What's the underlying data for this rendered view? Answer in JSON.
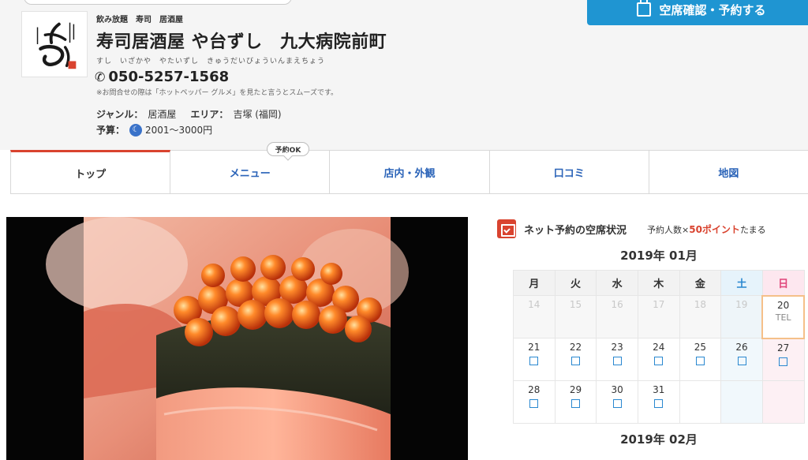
{
  "header": {
    "tags": [
      "飲み放題",
      "寿司",
      "居酒屋"
    ],
    "shop_name": "寿司居酒屋 や台ずし　九大病院前町",
    "shop_kana": "すし　いざかや　やたいずし　きゅうだいびょういんまえちょう",
    "phone": "050-5257-1568",
    "phone_note": "※お問合せの際は「ホットペッパー グルメ」を見たと言うとスムーズです。",
    "genre_label": "ジャンル：",
    "genre_value": "居酒屋",
    "area_label": "エリア：",
    "area_value": "吉塚 (福岡)",
    "budget_label": "予算：",
    "budget_value": "2001～3000円",
    "reserve_button": "空席確認・予約する"
  },
  "tabs": {
    "badge": "予約OK",
    "items": [
      {
        "label": "トップ"
      },
      {
        "label": "メニュー"
      },
      {
        "label": "店内・外観"
      },
      {
        "label": "口コミ"
      },
      {
        "label": "地図"
      }
    ]
  },
  "availability": {
    "title": "ネット予約の空席状況",
    "sub_prefix": "予約人数×",
    "sub_points": "50ポイント",
    "sub_suffix": "たまる",
    "month_jan": "2019年 01月",
    "month_feb": "2019年 02月",
    "weekdays": [
      "月",
      "火",
      "水",
      "木",
      "金",
      "土",
      "日"
    ],
    "rows": [
      [
        {
          "day": "14",
          "state": "past"
        },
        {
          "day": "15",
          "state": "past"
        },
        {
          "day": "16",
          "state": "past"
        },
        {
          "day": "17",
          "state": "past"
        },
        {
          "day": "18",
          "state": "past"
        },
        {
          "day": "19",
          "state": "past"
        },
        {
          "day": "20",
          "state": "today",
          "text": "TEL"
        }
      ],
      [
        {
          "day": "21",
          "state": "open"
        },
        {
          "day": "22",
          "state": "open"
        },
        {
          "day": "23",
          "state": "open"
        },
        {
          "day": "24",
          "state": "open"
        },
        {
          "day": "25",
          "state": "open"
        },
        {
          "day": "26",
          "state": "open"
        },
        {
          "day": "27",
          "state": "open"
        }
      ],
      [
        {
          "day": "28",
          "state": "open"
        },
        {
          "day": "29",
          "state": "open"
        },
        {
          "day": "30",
          "state": "open"
        },
        {
          "day": "31",
          "state": "open"
        },
        {
          "day": "",
          "state": "empty"
        },
        {
          "day": "",
          "state": "empty"
        },
        {
          "day": "",
          "state": "empty"
        }
      ]
    ]
  },
  "colors": {
    "accent_red": "#d9432f",
    "link_blue": "#2a63b8",
    "reserve_blue": "#1f95d2",
    "saturday": "#2a88d0",
    "sunday": "#e0457a"
  }
}
